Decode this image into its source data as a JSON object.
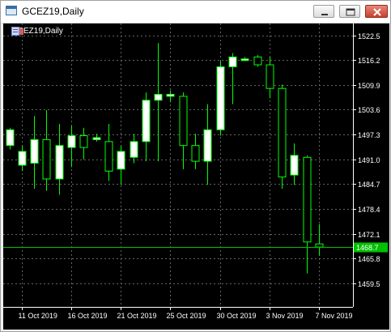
{
  "window": {
    "title": "GCEZ19,Daily"
  },
  "chart_header": {
    "label": "GCEZ19,Daily",
    "icon": "indicator-list-icon"
  },
  "colors": {
    "background": "#000000",
    "bull_body": "#ffffff",
    "bear_body": "#000000",
    "wick": "#00ff00",
    "grid": "#646464",
    "axis_text": "#ffffff",
    "price_line": "#00c000",
    "price_label_bg": "#00c000"
  },
  "price_label": "1468.7",
  "chart_data": {
    "type": "candlestick",
    "title": "GCEZ19,Daily",
    "xlabel": "",
    "ylabel": "",
    "ylim": [
      1453.5,
      1525.5
    ],
    "yticks": [
      1522.5,
      1516.2,
      1509.9,
      1503.6,
      1497.3,
      1491.0,
      1484.7,
      1478.4,
      1472.1,
      1465.8,
      1459.5
    ],
    "ytick_labels": [
      "1522.5",
      "1516.2",
      "1509.9",
      "1503.6",
      "1497.3",
      "1491.0",
      "1484.7",
      "1478.4",
      "1472.1",
      "1465.8",
      "1459.5"
    ],
    "x_labels": [
      {
        "text": "11 Oct 2019",
        "index": 1
      },
      {
        "text": "16 Oct 2019",
        "index": 5
      },
      {
        "text": "21 Oct 2019",
        "index": 9
      },
      {
        "text": "25 Oct 2019",
        "index": 13
      },
      {
        "text": "30 Oct 2019",
        "index": 17
      },
      {
        "text": "3 Nov 2019",
        "index": 21
      },
      {
        "text": "7 Nov 2019",
        "index": 25
      }
    ],
    "current_price": 1468.7,
    "grid": true,
    "candles": [
      {
        "o": 1494.5,
        "h": 1499.0,
        "l": 1493.5,
        "c": 1498.5
      },
      {
        "o": 1489.5,
        "h": 1494.5,
        "l": 1488.0,
        "c": 1493.0
      },
      {
        "o": 1490.0,
        "h": 1502.0,
        "l": 1483.5,
        "c": 1496.0
      },
      {
        "o": 1496.0,
        "h": 1503.5,
        "l": 1483.0,
        "c": 1486.0
      },
      {
        "o": 1486.0,
        "h": 1500.0,
        "l": 1482.0,
        "c": 1494.5
      },
      {
        "o": 1494.0,
        "h": 1499.5,
        "l": 1489.0,
        "c": 1497.0
      },
      {
        "o": 1497.0,
        "h": 1499.0,
        "l": 1491.0,
        "c": 1494.0
      },
      {
        "o": 1496.0,
        "h": 1497.5,
        "l": 1495.5,
        "c": 1496.5
      },
      {
        "o": 1495.5,
        "h": 1500.0,
        "l": 1485.5,
        "c": 1488.0
      },
      {
        "o": 1488.5,
        "h": 1494.5,
        "l": 1484.5,
        "c": 1493.0
      },
      {
        "o": 1491.5,
        "h": 1497.5,
        "l": 1490.0,
        "c": 1495.5
      },
      {
        "o": 1495.5,
        "h": 1508.0,
        "l": 1490.5,
        "c": 1506.0
      },
      {
        "o": 1506.0,
        "h": 1520.5,
        "l": 1490.5,
        "c": 1507.5
      },
      {
        "o": 1507.0,
        "h": 1508.5,
        "l": 1505.5,
        "c": 1507.5
      },
      {
        "o": 1507.0,
        "h": 1508.0,
        "l": 1488.5,
        "c": 1494.5
      },
      {
        "o": 1494.5,
        "h": 1497.5,
        "l": 1488.5,
        "c": 1490.5
      },
      {
        "o": 1490.5,
        "h": 1505.0,
        "l": 1484.5,
        "c": 1498.5
      },
      {
        "o": 1498.5,
        "h": 1516.0,
        "l": 1497.0,
        "c": 1514.5
      },
      {
        "o": 1514.5,
        "h": 1518.0,
        "l": 1505.0,
        "c": 1517.0
      },
      {
        "o": 1516.5,
        "h": 1517.0,
        "l": 1516.0,
        "c": 1516.5
      },
      {
        "o": 1517.0,
        "h": 1517.5,
        "l": 1514.5,
        "c": 1515.0
      },
      {
        "o": 1515.0,
        "h": 1517.0,
        "l": 1506.5,
        "c": 1509.0
      },
      {
        "o": 1509.0,
        "h": 1510.0,
        "l": 1483.5,
        "c": 1486.5
      },
      {
        "o": 1487.0,
        "h": 1495.0,
        "l": 1484.5,
        "c": 1492.0
      },
      {
        "o": 1491.5,
        "h": 1492.0,
        "l": 1462.0,
        "c": 1470.0
      },
      {
        "o": 1469.5,
        "h": 1474.5,
        "l": 1466.5,
        "c": 1468.7
      }
    ]
  }
}
